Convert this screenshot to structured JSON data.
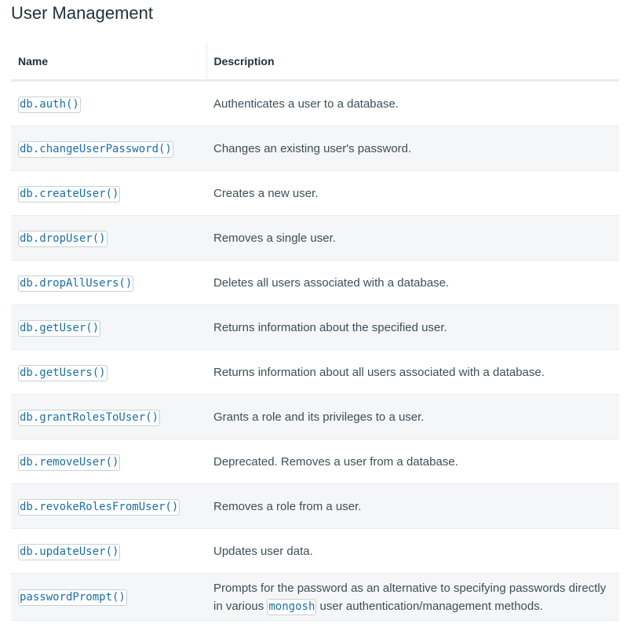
{
  "page": {
    "title": "User Management"
  },
  "table": {
    "headers": {
      "name": "Name",
      "description": "Description"
    },
    "rows": [
      {
        "method": "db.auth()",
        "description": "Authenticates a user to a database."
      },
      {
        "method": "db.changeUserPassword()",
        "description": "Changes an existing user's password."
      },
      {
        "method": "db.createUser()",
        "description": "Creates a new user."
      },
      {
        "method": "db.dropUser()",
        "description": "Removes a single user."
      },
      {
        "method": "db.dropAllUsers()",
        "description": "Deletes all users associated with a database."
      },
      {
        "method": "db.getUser()",
        "description": "Returns information about the specified user."
      },
      {
        "method": "db.getUsers()",
        "description": "Returns information about all users associated with a database."
      },
      {
        "method": "db.grantRolesToUser()",
        "description": "Grants a role and its privileges to a user."
      },
      {
        "method": "db.removeUser()",
        "description": "Deprecated. Removes a user from a database."
      },
      {
        "method": "db.revokeRolesFromUser()",
        "description": "Removes a role from a user."
      },
      {
        "method": "db.updateUser()",
        "description": "Updates user data."
      },
      {
        "method": "passwordPrompt()",
        "description_before": "Prompts for the password as an alternative to specifying passwords directly in various ",
        "description_code": "mongosh",
        "description_after": " user authentication/management methods."
      }
    ]
  },
  "colors": {
    "link": "#1a6fa5",
    "text": "#3d4f58",
    "row_alt": "#f5f6f7",
    "border": "#e7eeec"
  }
}
